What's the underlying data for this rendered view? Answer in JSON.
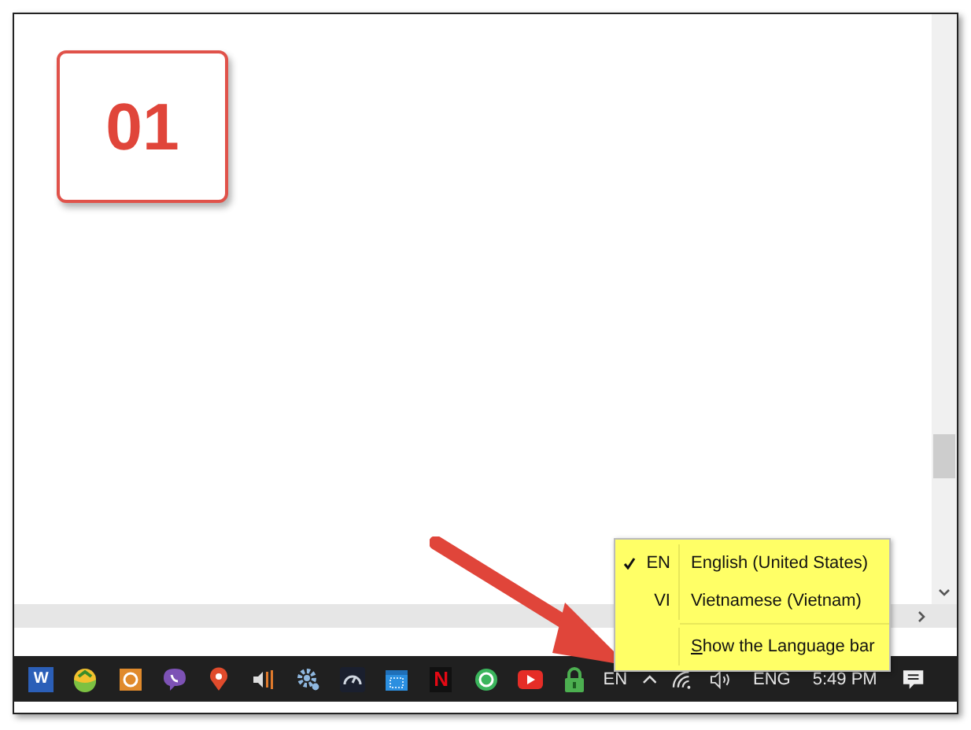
{
  "step_badge": "01",
  "language_menu": {
    "items": [
      {
        "code": "EN",
        "label": "English (United States)",
        "checked": true
      },
      {
        "code": "VI",
        "label": "Vietnamese (Vietnam)",
        "checked": false
      }
    ],
    "footer": {
      "access_key": "S",
      "label_rest": "how the Language bar"
    }
  },
  "taskbar": {
    "apps": [
      {
        "kind": "word",
        "glyph": "W"
      },
      {
        "kind": "ball"
      },
      {
        "kind": "ring-tile"
      },
      {
        "kind": "chat-bubble"
      },
      {
        "kind": "map-pin"
      },
      {
        "kind": "speaker"
      },
      {
        "kind": "gear"
      },
      {
        "kind": "gauge"
      },
      {
        "kind": "calendar"
      },
      {
        "kind": "letter-tile",
        "glyph": "N"
      },
      {
        "kind": "ring-circle"
      },
      {
        "kind": "play"
      },
      {
        "kind": "lock"
      }
    ],
    "input_indicator": "EN",
    "language": "ENG",
    "clock": "5:49 PM"
  }
}
